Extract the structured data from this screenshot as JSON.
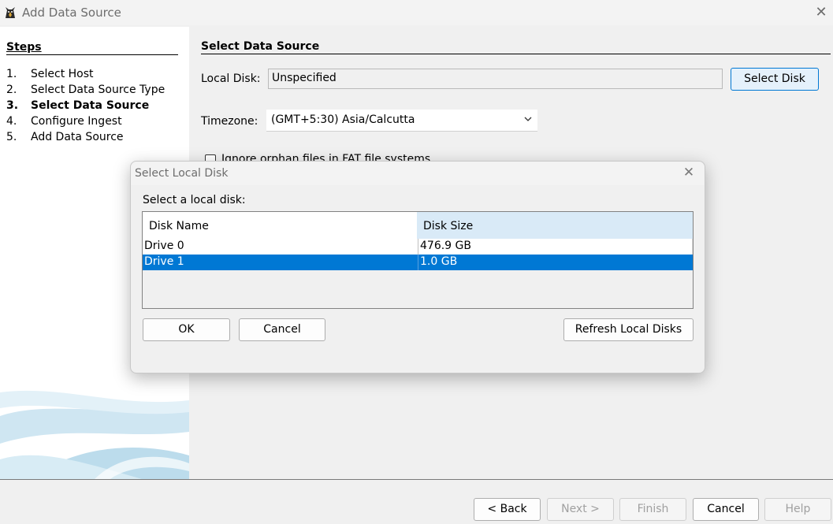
{
  "window": {
    "title": "Add Data Source",
    "close_glyph": "✕"
  },
  "steps": {
    "heading": "Steps",
    "items": [
      {
        "num": "1.",
        "label": "Select Host",
        "current": false
      },
      {
        "num": "2.",
        "label": "Select Data Source Type",
        "current": false
      },
      {
        "num": "3.",
        "label": "Select Data Source",
        "current": true
      },
      {
        "num": "4.",
        "label": "Configure Ingest",
        "current": false
      },
      {
        "num": "5.",
        "label": "Add Data Source",
        "current": false
      }
    ]
  },
  "content": {
    "heading": "Select Data Source",
    "local_disk_label": "Local Disk:",
    "local_disk_value": "Unspecified",
    "select_disk_button": "Select Disk",
    "timezone_label": "Timezone:",
    "timezone_value": "(GMT+5:30) Asia/Calcutta",
    "ignore_orphan_label": "Ignore orphan files in FAT file systems"
  },
  "footer": {
    "back": "< Back",
    "next": "Next >",
    "finish": "Finish",
    "cancel": "Cancel",
    "help": "Help"
  },
  "dialog": {
    "title": "Select Local Disk",
    "close_glyph": "✕",
    "prompt": "Select a local disk:",
    "columns": [
      "Disk Name",
      "Disk Size"
    ],
    "rows": [
      {
        "name": "Drive 0",
        "size": "476.9 GB",
        "selected": false
      },
      {
        "name": "Drive 1",
        "size": "1.0 GB",
        "selected": true
      }
    ],
    "ok": "OK",
    "cancel": "Cancel",
    "refresh": "Refresh Local Disks"
  },
  "colors": {
    "accent": "#0078d4",
    "selected_row_bg": "#0078d4",
    "header_highlight": "#d9eaf7"
  }
}
